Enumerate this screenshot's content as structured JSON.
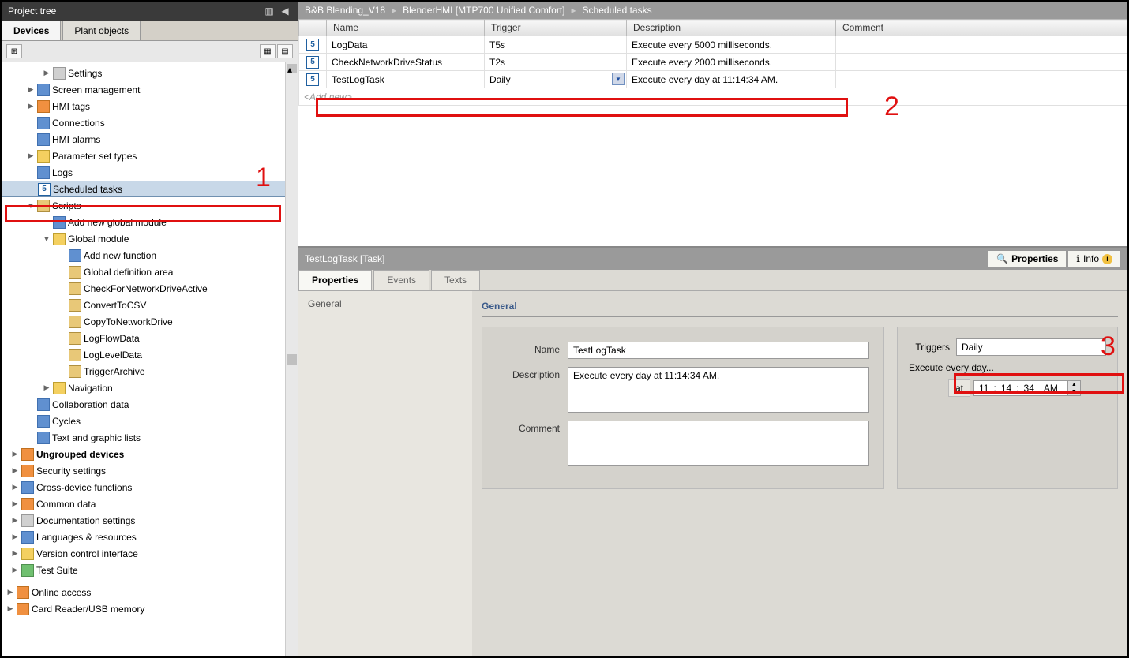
{
  "left": {
    "title": "Project tree",
    "tabs": {
      "devices": "Devices",
      "plant": "Plant objects"
    }
  },
  "tree": [
    {
      "label": "Settings",
      "indent": 2,
      "icon": "ic-gray",
      "exp": "▶"
    },
    {
      "label": "Screen management",
      "indent": 1,
      "icon": "ic-blue",
      "exp": "▶"
    },
    {
      "label": "HMI tags",
      "indent": 1,
      "icon": "ic-orange",
      "exp": "▶"
    },
    {
      "label": "Connections",
      "indent": 1,
      "icon": "ic-blue",
      "exp": ""
    },
    {
      "label": "HMI alarms",
      "indent": 1,
      "icon": "ic-blue",
      "exp": ""
    },
    {
      "label": "Parameter set types",
      "indent": 1,
      "icon": "ic-folder",
      "exp": "▶"
    },
    {
      "label": "Logs",
      "indent": 1,
      "icon": "ic-blue",
      "exp": ""
    },
    {
      "label": "Scheduled tasks",
      "indent": 1,
      "icon": "ic-num5",
      "exp": "",
      "selected": true,
      "iconText": "5"
    },
    {
      "label": "Scripts",
      "indent": 1,
      "icon": "ic-script",
      "exp": "▼"
    },
    {
      "label": "Add new global module",
      "indent": 2,
      "icon": "ic-blue",
      "exp": ""
    },
    {
      "label": "Global module",
      "indent": 2,
      "icon": "ic-folder",
      "exp": "▼"
    },
    {
      "label": "Add new function",
      "indent": 3,
      "icon": "ic-blue",
      "exp": ""
    },
    {
      "label": "Global definition area",
      "indent": 3,
      "icon": "ic-script",
      "exp": ""
    },
    {
      "label": "CheckForNetworkDriveActive",
      "indent": 3,
      "icon": "ic-script",
      "exp": ""
    },
    {
      "label": "ConvertToCSV",
      "indent": 3,
      "icon": "ic-script",
      "exp": ""
    },
    {
      "label": "CopyToNetworkDrive",
      "indent": 3,
      "icon": "ic-script",
      "exp": ""
    },
    {
      "label": "LogFlowData",
      "indent": 3,
      "icon": "ic-script",
      "exp": ""
    },
    {
      "label": "LogLevelData",
      "indent": 3,
      "icon": "ic-script",
      "exp": ""
    },
    {
      "label": "TriggerArchive",
      "indent": 3,
      "icon": "ic-script",
      "exp": ""
    },
    {
      "label": "Navigation",
      "indent": 2,
      "icon": "ic-folder",
      "exp": "▶"
    },
    {
      "label": "Collaboration data",
      "indent": 1,
      "icon": "ic-blue",
      "exp": ""
    },
    {
      "label": "Cycles",
      "indent": 1,
      "icon": "ic-blue",
      "exp": ""
    },
    {
      "label": "Text and graphic lists",
      "indent": 1,
      "icon": "ic-blue",
      "exp": ""
    },
    {
      "label": "Ungrouped devices",
      "indent": 0,
      "icon": "ic-orange",
      "exp": "▶",
      "bold": true
    },
    {
      "label": "Security settings",
      "indent": 0,
      "icon": "ic-orange",
      "exp": "▶"
    },
    {
      "label": "Cross-device functions",
      "indent": 0,
      "icon": "ic-blue",
      "exp": "▶"
    },
    {
      "label": "Common data",
      "indent": 0,
      "icon": "ic-orange",
      "exp": "▶"
    },
    {
      "label": "Documentation settings",
      "indent": 0,
      "icon": "ic-gray",
      "exp": "▶"
    },
    {
      "label": "Languages & resources",
      "indent": 0,
      "icon": "ic-blue",
      "exp": "▶"
    },
    {
      "label": "Version control interface",
      "indent": 0,
      "icon": "ic-folder",
      "exp": "▶"
    },
    {
      "label": "Test Suite",
      "indent": 0,
      "icon": "ic-green",
      "exp": "▶"
    }
  ],
  "tree_bottom": [
    {
      "label": "Online access",
      "icon": "ic-orange",
      "exp": "▶"
    },
    {
      "label": "Card Reader/USB memory",
      "icon": "ic-orange",
      "exp": "▶"
    }
  ],
  "breadcrumb": {
    "p1": "B&B Blending_V18",
    "p2": "BlenderHMI [MTP700 Unified Comfort]",
    "p3": "Scheduled tasks"
  },
  "table": {
    "headers": {
      "name": "Name",
      "trigger": "Trigger",
      "description": "Description",
      "comment": "Comment"
    },
    "rows": [
      {
        "name": "LogData",
        "trigger": "T5s",
        "description": "Execute every 5000 milliseconds.",
        "comment": ""
      },
      {
        "name": "CheckNetworkDriveStatus",
        "trigger": "T2s",
        "description": "Execute every 2000 milliseconds.",
        "comment": ""
      },
      {
        "name": "TestLogTask",
        "trigger": "Daily",
        "description": "Execute every day at 11:14:34 AM.",
        "comment": ""
      }
    ],
    "addnew": "<Add new>"
  },
  "prop": {
    "title": "TestLogTask [Task]",
    "htabs": {
      "properties": "Properties",
      "info": "Info"
    },
    "subtabs": {
      "properties": "Properties",
      "events": "Events",
      "texts": "Texts"
    },
    "sidebar": "General",
    "section": "General",
    "labels": {
      "name": "Name",
      "description": "Description",
      "comment": "Comment",
      "triggers": "Triggers",
      "execute": "Execute every day...",
      "at": "at"
    },
    "vals": {
      "name": "TestLogTask",
      "description": "Execute every day at 11:14:34 AM.",
      "comment": "",
      "trigger": "Daily",
      "time_h": "11",
      "time_m": "14",
      "time_s": "34",
      "time_ap": "AM"
    }
  },
  "annotations": {
    "n1": "1",
    "n2": "2",
    "n3": "3"
  }
}
